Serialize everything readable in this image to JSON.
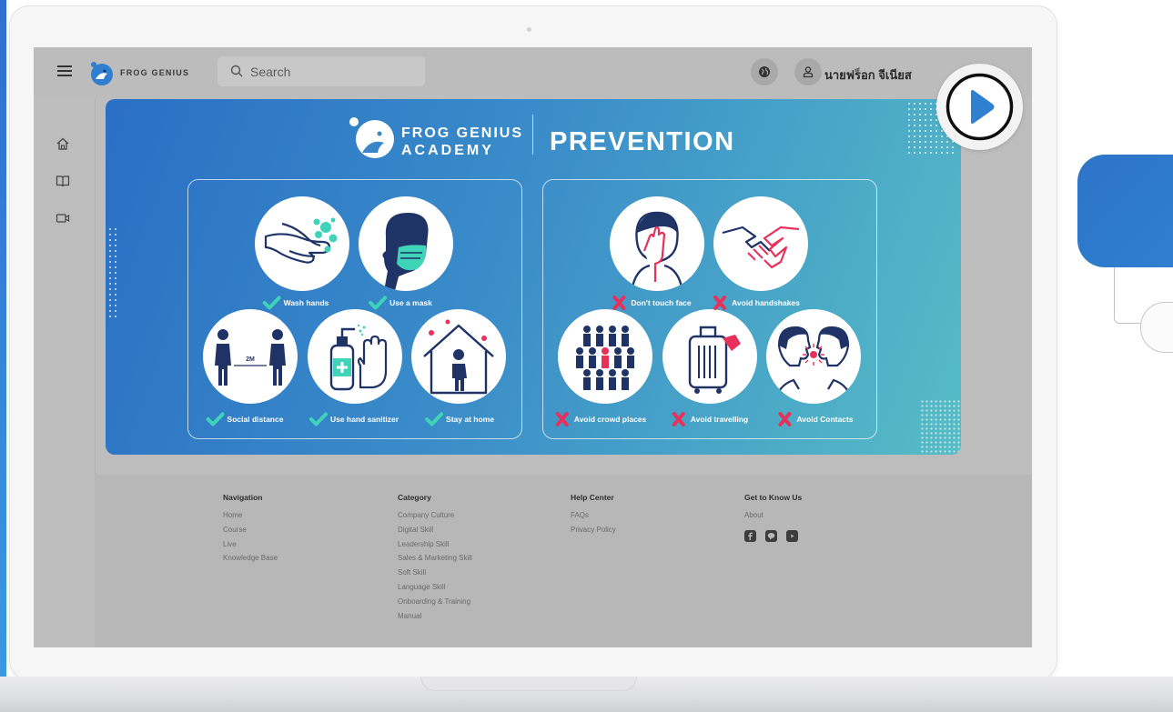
{
  "app": {
    "brand_name": "FROG GENIUS",
    "search_placeholder": "Search",
    "username": "นายฟร็อก จีเนียส"
  },
  "banner": {
    "academy_line1": "FROG GENIUS",
    "academy_line2": "ACADEMY",
    "title": "PREVENTION",
    "do_items": [
      "Wash hands",
      "Use a mask",
      "Social distance",
      "Use hand sanitizer",
      "Stay at home"
    ],
    "dont_items": [
      "Don't touch face",
      "Avoid handshakes",
      "Avoid crowd places",
      "Avoid travelling",
      "Avoid Contacts"
    ],
    "distance_label": "2M"
  },
  "footer": {
    "navigation": {
      "heading": "Navigation",
      "links": [
        "Home",
        "Course",
        "Live",
        "Knowledge Base"
      ]
    },
    "category": {
      "heading": "Category",
      "links": [
        "Company Culture",
        "Digital Skill",
        "Leadership Skill",
        "Sales & Marketing Skill",
        "Soft Skill",
        "Language Skill",
        "Onboarding & Training",
        "Manual"
      ]
    },
    "help": {
      "heading": "Help Center",
      "links": [
        "FAQs",
        "Privacy Policy"
      ]
    },
    "know": {
      "heading": "Get to Know Us",
      "links": [
        "About"
      ]
    },
    "social_icons": [
      "facebook-icon",
      "line-icon",
      "youtube-icon"
    ]
  },
  "colors": {
    "banner_start": "#2a6fc4",
    "banner_end": "#56bcc6",
    "check": "#3fd3b8",
    "cross": "#e8315a",
    "navy": "#1f3366",
    "play": "#2f80d0"
  }
}
